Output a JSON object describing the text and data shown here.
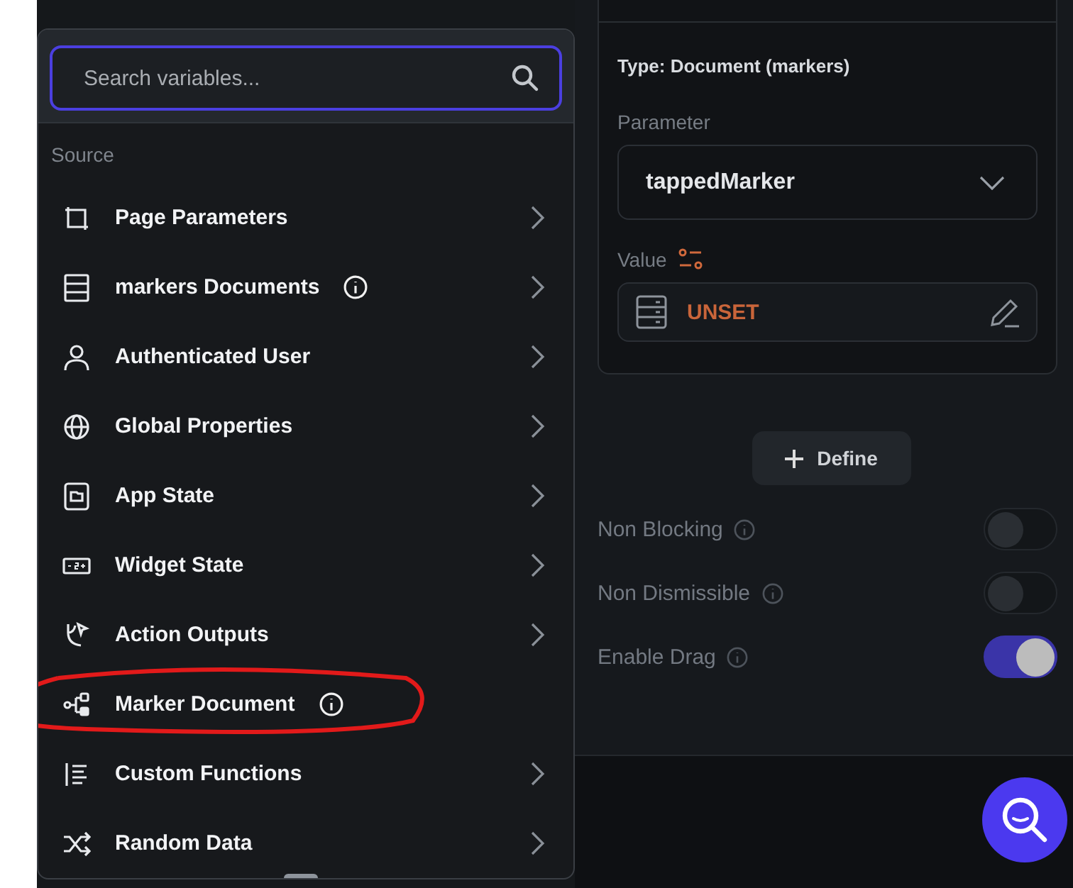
{
  "variable_menu": {
    "search": {
      "placeholder": "Search variables..."
    },
    "section_label": "Source",
    "items": [
      {
        "label": "Page Parameters",
        "info": false,
        "chevron": true
      },
      {
        "label": "markers Documents",
        "info": true,
        "chevron": true
      },
      {
        "label": "Authenticated User",
        "info": false,
        "chevron": true
      },
      {
        "label": "Global Properties",
        "info": false,
        "chevron": true
      },
      {
        "label": "App State",
        "info": false,
        "chevron": true
      },
      {
        "label": "Widget State",
        "info": false,
        "chevron": true
      },
      {
        "label": "Action Outputs",
        "info": false,
        "chevron": true
      },
      {
        "label": "Marker Document",
        "info": true,
        "chevron": false,
        "annotated": true
      },
      {
        "label": "Custom Functions",
        "info": false,
        "chevron": true
      },
      {
        "label": "Random Data",
        "info": false,
        "chevron": true
      }
    ]
  },
  "properties": {
    "type_label": "Type: Document (markers)",
    "parameter_label": "Parameter",
    "parameter_value": "tappedMarker",
    "value_label": "Value",
    "value": "UNSET",
    "define_button": "Define",
    "toggles": [
      {
        "label": "Non Blocking",
        "on": false
      },
      {
        "label": "Non Dismissible",
        "on": false
      },
      {
        "label": "Enable Drag",
        "on": true
      }
    ]
  }
}
